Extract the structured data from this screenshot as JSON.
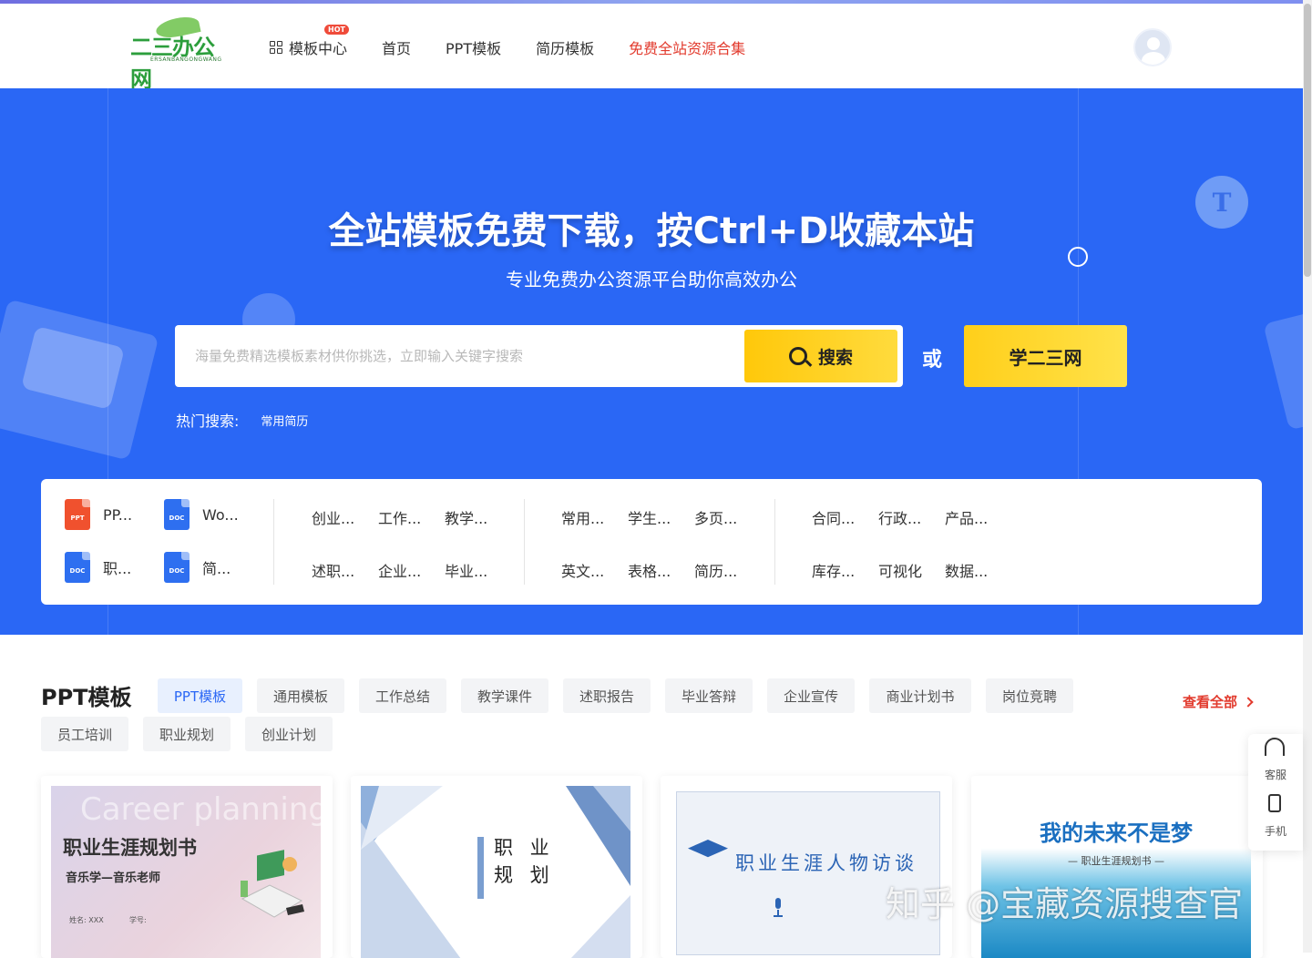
{
  "header": {
    "logo_text": "二三办公网",
    "logo_sub": "ERSANBANGONGWANG",
    "nav": [
      {
        "label": "模板中心",
        "badge": "HOT"
      },
      {
        "label": "首页"
      },
      {
        "label": "PPT模板"
      },
      {
        "label": "简历模板"
      },
      {
        "label": "免费全站资源合集"
      }
    ]
  },
  "hero": {
    "title": "全站模板免费下载，按Ctrl+D收藏本站",
    "subtitle": "专业免费办公资源平台助你高效办公",
    "search_placeholder": "海量免费精选模板素材供你挑选，立即输入关键字搜索",
    "search_button": "搜索",
    "or": "或",
    "learn_button": "学二三网",
    "hot_label": "热门搜索:",
    "hot_tags": [
      "常用简历"
    ],
    "t_badge": "T"
  },
  "categories": {
    "files": [
      {
        "icon": "PPT",
        "label": "PP..."
      },
      {
        "icon": "DOC",
        "label": "Wo..."
      },
      {
        "icon": "DOC",
        "label": "职..."
      },
      {
        "icon": "DOC",
        "label": "简..."
      }
    ],
    "group1": [
      "创业...",
      "工作...",
      "教学...",
      "述职...",
      "企业...",
      "毕业..."
    ],
    "group2": [
      "常用...",
      "学生...",
      "多页...",
      "英文...",
      "表格...",
      "简历..."
    ],
    "group3": [
      "合同...",
      "行政...",
      "产品...",
      "库存...",
      "可视化",
      "数据..."
    ]
  },
  "ppt_section": {
    "title": "PPT模板",
    "tabs": [
      "PPT模板",
      "通用模板",
      "工作总结",
      "教学课件",
      "述职报告",
      "毕业答辩",
      "企业宣传",
      "商业计划书",
      "岗位竞聘",
      "员工培训",
      "职业规划",
      "创业计划"
    ],
    "active_tab": "PPT模板",
    "view_all": "查看全部",
    "cards": [
      {
        "en": "Career planning",
        "title": "职业生涯规划书",
        "subtitle": "音乐学—音乐老师",
        "meta1": "姓名: XXX",
        "meta2": "学号:"
      },
      {
        "title_line1": "职 业",
        "title_line2": "规 划"
      },
      {
        "title": "职业生涯人物访谈"
      },
      {
        "title": "我的未来不是梦",
        "subtitle": "— 职业生涯规划书 —"
      }
    ]
  },
  "float": {
    "service": "客服",
    "phone": "手机"
  },
  "watermark": "知乎 @宝藏资源搜查官",
  "colors": {
    "primary": "#2a67f5",
    "accent": "#ffc80a",
    "red": "#e23b2e"
  }
}
